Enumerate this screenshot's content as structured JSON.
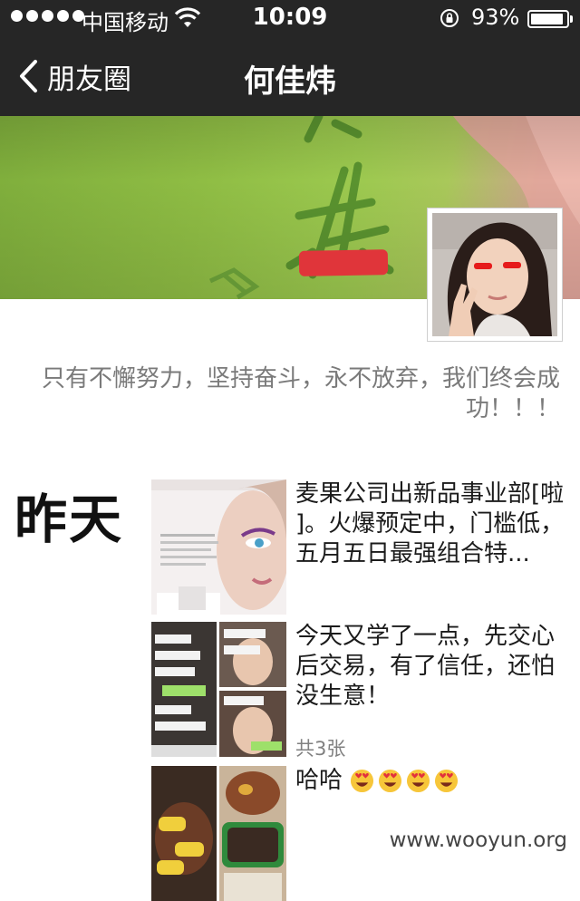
{
  "status_bar": {
    "carrier": "中国移动",
    "time": "10:09",
    "battery": "93%",
    "battery_level": 0.93,
    "signal_dots": 5
  },
  "nav": {
    "back_label": "朋友圈",
    "title": "何佳炜"
  },
  "profile": {
    "signature": "只有不懈努力，坚持奋斗，永不放弃，我们终会成功！！！"
  },
  "timeline": {
    "day_label": "昨天",
    "posts": [
      {
        "text": "麦果公司出新品事业部[啦 ]。火爆预定中，门槛低，五月五日最强组合特...",
        "thumb": "beauty-product-ad"
      },
      {
        "text": "今天又学了一点，先交心后交易，有了信任，还怕没生意！",
        "count": "共3张",
        "thumb": "chat-screenshots"
      },
      {
        "text": "哈哈",
        "emojis": [
          "heart-eyes-emoji",
          "heart-eyes-emoji",
          "heart-eyes-emoji",
          "heart-eyes-emoji"
        ],
        "thumb": "food-photos"
      }
    ]
  },
  "watermark": "www.wooyun.org",
  "colors": {
    "nav_bg": "#262626",
    "cover_green": "#8fbd44",
    "stamp_red": "#e0353a",
    "signature_gray": "#7a7a7a"
  }
}
